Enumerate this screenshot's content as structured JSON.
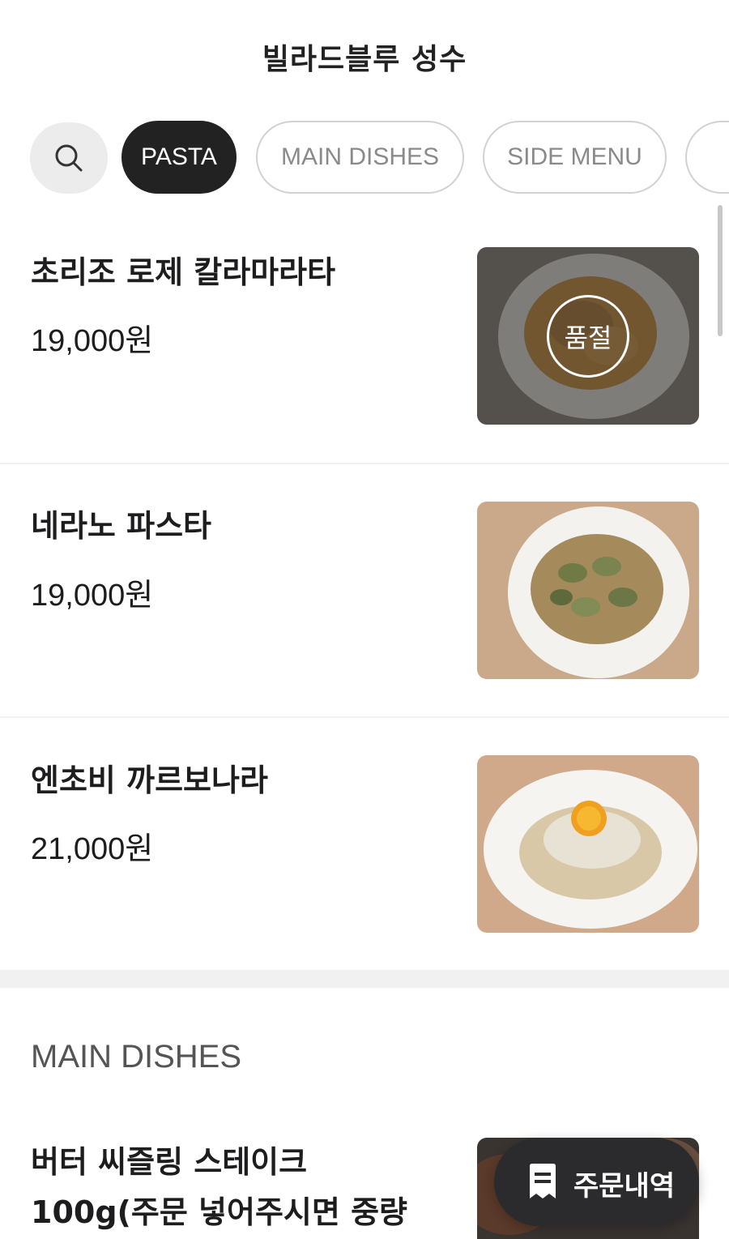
{
  "header": {
    "title": "빌라드블루 성수"
  },
  "tabs": {
    "search_icon": "search-icon",
    "items": [
      {
        "label": "PASTA",
        "active": true
      },
      {
        "label": "MAIN DISHES",
        "active": false
      },
      {
        "label": "SIDE MENU",
        "active": false
      }
    ]
  },
  "menu": {
    "items": [
      {
        "name": "초리조 로제 칼라마라타",
        "price": "19,000원",
        "sold_out": true,
        "badge": "품절"
      },
      {
        "name": "네라노 파스타",
        "price": "19,000원",
        "sold_out": false
      },
      {
        "name": "엔초비 까르보나라",
        "price": "21,000원",
        "sold_out": false
      }
    ]
  },
  "main_section": {
    "title": "MAIN DISHES",
    "items": [
      {
        "name_line1": "버터 씨즐링 스테이크",
        "name_line2": "100g(주문 넣어주시면 중량"
      }
    ]
  },
  "order_button": {
    "label": "주문내역",
    "icon": "receipt-icon"
  },
  "colors": {
    "active_tab": "#222222",
    "tab_border": "#d2d2d2",
    "order_button": "#2b2b2e"
  }
}
